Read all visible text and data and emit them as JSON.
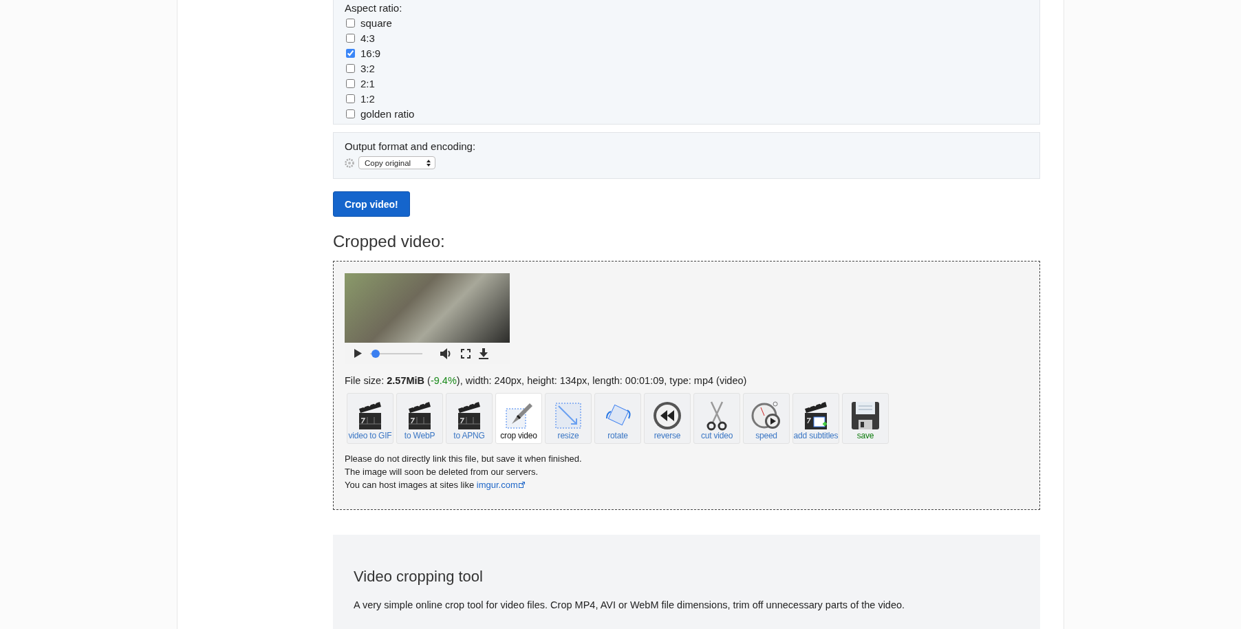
{
  "aspect_ratio": {
    "label": "Aspect ratio:",
    "options": [
      {
        "label": "square",
        "checked": false
      },
      {
        "label": "4:3",
        "checked": false
      },
      {
        "label": "16:9",
        "checked": true
      },
      {
        "label": "3:2",
        "checked": false
      },
      {
        "label": "2:1",
        "checked": false
      },
      {
        "label": "1:2",
        "checked": false
      },
      {
        "label": "golden ratio",
        "checked": false
      }
    ]
  },
  "output": {
    "label": "Output format and encoding:",
    "select_value": "Copy original"
  },
  "crop_button": "Crop video!",
  "result": {
    "heading": "Cropped video:",
    "player": {
      "level": 0.03
    },
    "file_info": {
      "prefix": "File size: ",
      "size": "2.57MiB",
      "open": " (",
      "change": "-9.4%",
      "rest": "), width: 240px, height: 134px, length: 00:01:09, type: mp4 (video)"
    },
    "tools": [
      {
        "label": "video to GIF",
        "kind": "link",
        "selected": false
      },
      {
        "label": "to WebP",
        "kind": "link",
        "selected": false
      },
      {
        "label": "to APNG",
        "kind": "link",
        "selected": false
      },
      {
        "label": "crop video",
        "kind": "link",
        "selected": true
      },
      {
        "label": "resize",
        "kind": "link",
        "selected": false
      },
      {
        "label": "rotate",
        "kind": "link",
        "selected": false
      },
      {
        "label": "reverse",
        "kind": "link",
        "selected": false
      },
      {
        "label": "cut video",
        "kind": "link",
        "selected": false
      },
      {
        "label": "speed",
        "kind": "link",
        "selected": false
      },
      {
        "label": "add subtitles",
        "kind": "link",
        "selected": false
      },
      {
        "label": "save",
        "kind": "save",
        "selected": false
      }
    ],
    "notes": [
      "Please do not directly link this file, but save it when finished.",
      "The image will soon be deleted from our servers."
    ],
    "host_note": {
      "text": "You can host images at sites like ",
      "link": "imgur.com"
    }
  },
  "about": {
    "heading": "Video cropping tool",
    "text": "A very simple online crop tool for video files. Crop MP4, AVI or WebM file dimensions, trim off unnecessary parts of the video."
  }
}
